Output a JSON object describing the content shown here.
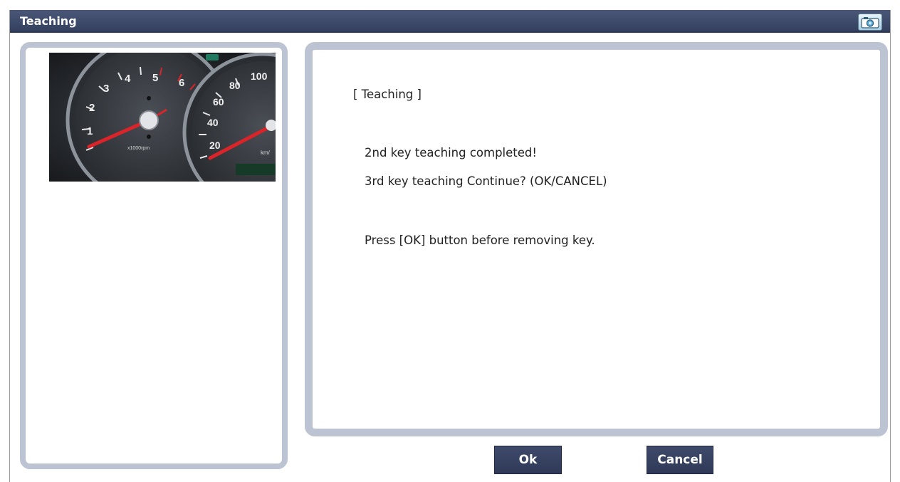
{
  "window": {
    "title": "Teaching",
    "camera_icon": "camera-icon"
  },
  "image_panel": {
    "image": "instrument-cluster-gauges",
    "tach_labels": [
      "1",
      "2",
      "3",
      "4",
      "5",
      "6"
    ],
    "tach_unit": "x1000rpm",
    "speed_labels": [
      "20",
      "40",
      "60",
      "80",
      "100"
    ],
    "speed_unit": "km/"
  },
  "message": {
    "heading": "[ Teaching ]",
    "line1": "2nd key teaching completed!",
    "line2": "3rd key teaching Continue? (OK/CANCEL)",
    "line3": "Press [OK] button before removing key."
  },
  "buttons": {
    "ok": "Ok",
    "cancel": "Cancel"
  },
  "colors": {
    "titlebar": "#3b4767",
    "panel_border": "#bcc4d3",
    "button": "#36405f",
    "needle": "#d9242a"
  }
}
